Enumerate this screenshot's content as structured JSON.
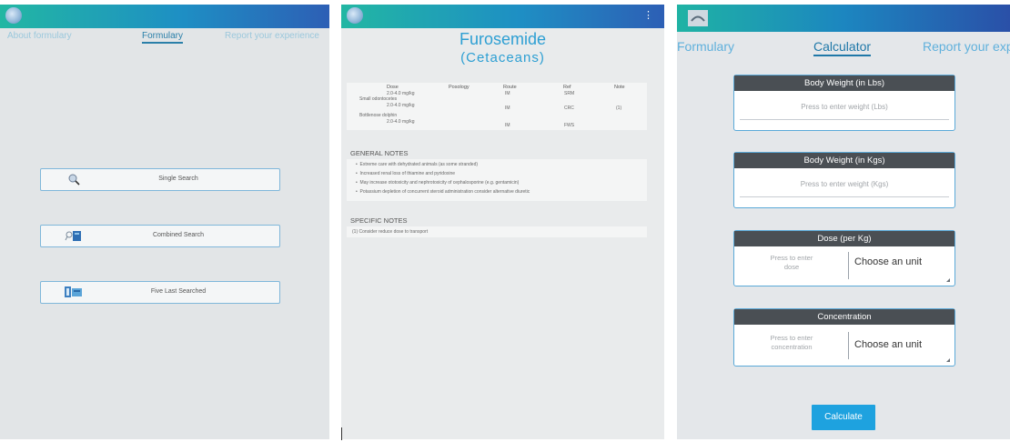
{
  "panel1": {
    "tabs": [
      "About formulary",
      "Formulary",
      "Report your experience"
    ],
    "buttons": [
      {
        "label": "Single Search",
        "icon": "magnifier-icon"
      },
      {
        "label": "Combined Search",
        "icon": "combined-search-icon"
      },
      {
        "label": "Five Last Searched",
        "icon": "recent-searches-icon"
      }
    ]
  },
  "panel2": {
    "menu_icon": "⋮",
    "drug_name": "Furosemide",
    "species": "(Cetaceans)",
    "table": {
      "headers": [
        "Dose",
        "Posology",
        "Route",
        "Ref",
        "Note"
      ],
      "groups": [
        {
          "group": "",
          "dose": "2.0-4.0 mg/kg",
          "route": "IM",
          "ref": "SRM",
          "note": ""
        },
        {
          "group": "Small odontocetes",
          "dose": "2.0-4.0 mg/kg",
          "route": "IM",
          "ref": "CRC",
          "note": "(1)"
        },
        {
          "group": "Bottlenose dolphin",
          "dose": "2.0-4.0 mg/kg",
          "route": "IM",
          "ref": "FWS",
          "note": ""
        }
      ]
    },
    "general_notes_title": "GENERAL NOTES",
    "general_notes": [
      "Extreme care with dehydrated animals (as some stranded)",
      "Increased renal loss of thiamine and pyridoxine",
      "May increase ototoxicity and nephrotoxicity of cephalosporine (e.g. gentamicin)",
      "Potassium depletion of concurrent steroid administration consider alternative diuretic"
    ],
    "specific_notes_title": "SPECIFIC NOTES",
    "specific_notes": [
      "(1) Consider reduce dose to transport"
    ]
  },
  "panel3": {
    "tabs": [
      "Formulary",
      "Calculator",
      "Report your expe"
    ],
    "body_weight_lbs": {
      "title": "Body Weight (in Lbs)",
      "placeholder": "Press to enter weight (Lbs)"
    },
    "body_weight_kgs": {
      "title": "Body Weight (in Kgs)",
      "placeholder": "Press to enter weight (Kgs)"
    },
    "dose": {
      "title": "Dose (per Kg)",
      "placeholder_line1": "Press to enter",
      "placeholder_line2": "dose",
      "unit_label": "Choose an unit"
    },
    "concentration": {
      "title": "Concentration",
      "placeholder_line1": "Press to enter",
      "placeholder_line2": "concentration",
      "unit_label": "Choose an unit"
    },
    "calculate_label": "Calculate"
  }
}
